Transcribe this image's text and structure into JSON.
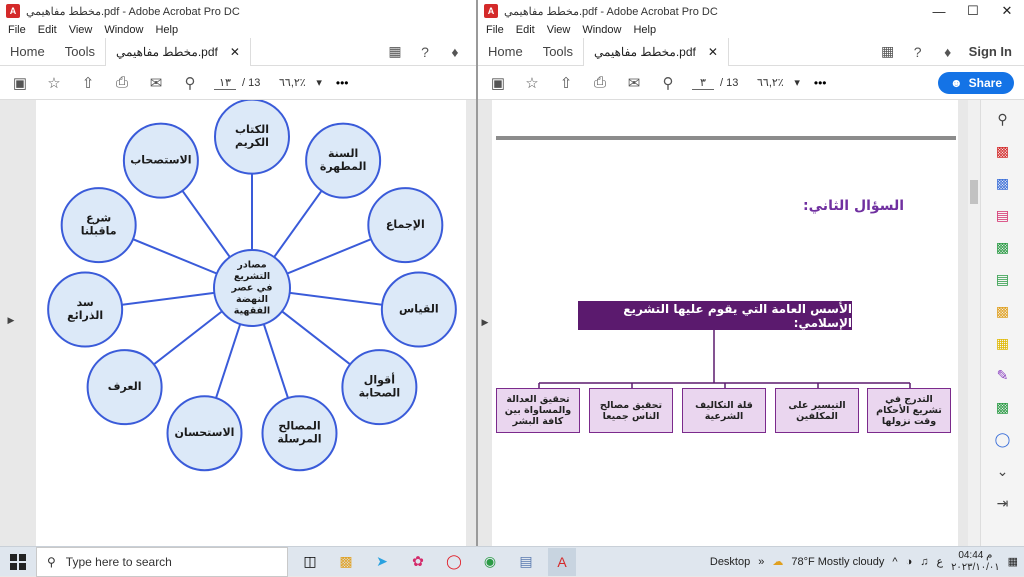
{
  "left_window": {
    "title": "مخطط مفاهيمي.pdf - Adobe Acrobat Pro DC",
    "menu": [
      "File",
      "Edit",
      "View",
      "Window",
      "Help"
    ],
    "nav_home": "Home",
    "nav_tools": "Tools",
    "doc_tab": "مخطط مفاهيمي.pdf",
    "page_current": "١٣",
    "page_total": "/ 13",
    "zoom": "٦٦,٢٪",
    "more": "•••",
    "diagram": {
      "center": "مصادر التشريع في عصر النهضة الفقهية",
      "nodes": [
        {
          "label": "الكتاب الكريم"
        },
        {
          "label": "السنة المطهرة"
        },
        {
          "label": "الإجماع"
        },
        {
          "label": "القياس"
        },
        {
          "label": "أقوال الصحابة"
        },
        {
          "label": "المصالح المرسلة"
        },
        {
          "label": "الاستحسان"
        },
        {
          "label": "العرف"
        },
        {
          "label": "سد الذرائع"
        },
        {
          "label": "شرع ماقبلنا"
        },
        {
          "label": "الاستصحاب"
        }
      ]
    }
  },
  "right_window": {
    "title": "مخطط مفاهيمي.pdf - Adobe Acrobat Pro DC",
    "menu": [
      "File",
      "Edit",
      "View",
      "Window",
      "Help"
    ],
    "nav_home": "Home",
    "nav_tools": "Tools",
    "doc_tab": "مخطط مفاهيمي.pdf",
    "sign_in": "Sign In",
    "share": "Share",
    "page_current": "٣",
    "page_total": "/ 13",
    "zoom": "٦٦,٢٪",
    "more": "•••",
    "question_title": "السؤال الثاني:",
    "tree_header": "الأسس العامة التي يقوم عليها التشريع الإسلامي:",
    "tree_leaves": [
      "التدرج في تشريع الأحكام وقت نزولها",
      "التيسير على المكلفين",
      "قلة التكاليف الشرعية",
      "تحقيق مصالح الناس جميعا",
      "تحقيق العدالة والمساواة بين كافة البشر"
    ]
  },
  "taskbar": {
    "search_placeholder": "Type here to search",
    "desktop": "Desktop",
    "weather": "78°F  Mostly cloudy",
    "lang": "ع",
    "time": "04:44 م",
    "date": "٢٠٢٣/١٠/٠١"
  },
  "colors": {
    "node_fill": "#dce9f8",
    "node_stroke": "#3a5bd9",
    "tree_header": "#5b1a6e",
    "tree_leaf": "#ead6ef",
    "question": "#7030a0",
    "share": "#1473e6"
  }
}
